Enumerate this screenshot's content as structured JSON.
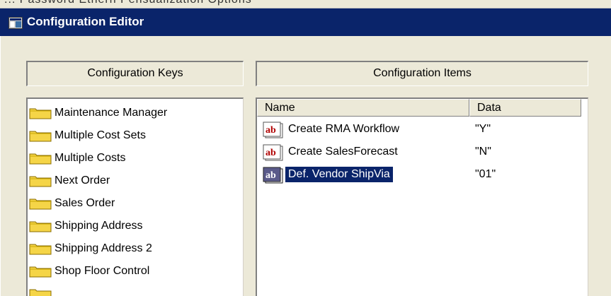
{
  "window": {
    "title": "Configuration Editor",
    "menu_strip_text": "...   Password   Ethern  Pensualization     Options"
  },
  "keys_panel": {
    "header": "Configuration Keys",
    "items": [
      {
        "label": "Maintenance Manager"
      },
      {
        "label": "Multiple Cost Sets"
      },
      {
        "label": "Multiple Costs"
      },
      {
        "label": "Next Order"
      },
      {
        "label": "Sales Order"
      },
      {
        "label": "Shipping Address"
      },
      {
        "label": "Shipping Address 2"
      },
      {
        "label": "Shop Floor Control"
      }
    ]
  },
  "items_panel": {
    "header": "Configuration Items",
    "columns": {
      "name": "Name",
      "data": "Data"
    },
    "rows": [
      {
        "name": "Create RMA Workflow",
        "data": "\"Y\"",
        "selected": false
      },
      {
        "name": "Create SalesForecast",
        "data": "\"N\"",
        "selected": false
      },
      {
        "name": "Def. Vendor ShipVia",
        "data": "\"01\"",
        "selected": true
      }
    ]
  },
  "colors": {
    "titlebar": "#0a246a",
    "face": "#ece9d8",
    "selection": "#0a246a",
    "folder": "#f5d547"
  }
}
